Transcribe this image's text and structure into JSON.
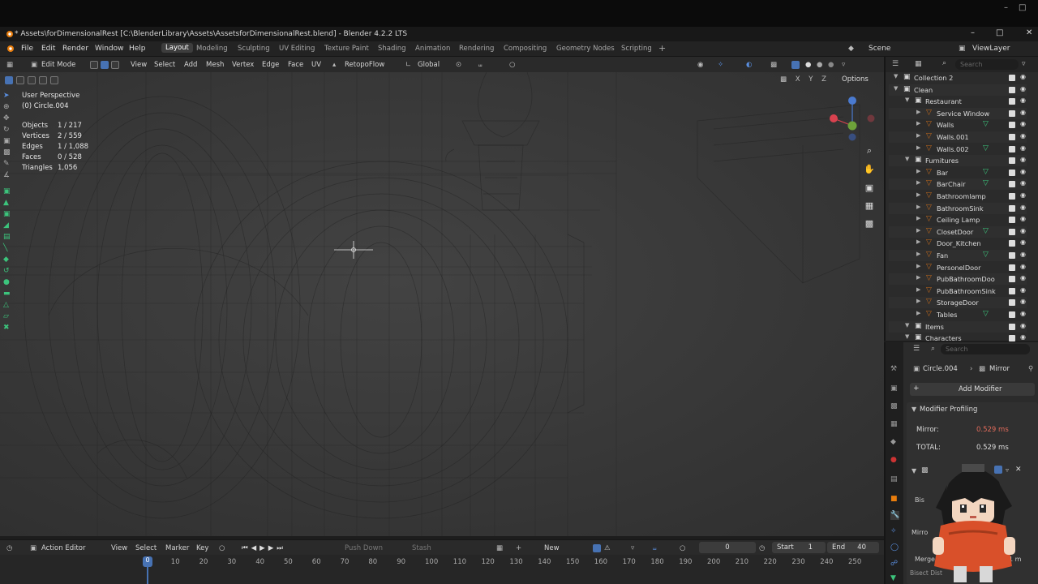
{
  "window": {
    "title": "* Assets\\forDimensionalRest [C:\\BlenderLibrary\\Assets\\AssetsforDimensionalRest.blend] - Blender 4.2.2 LTS"
  },
  "menu": {
    "items": [
      "File",
      "Edit",
      "Render",
      "Window",
      "Help"
    ],
    "workspaces": [
      "Layout",
      "Modeling",
      "Sculpting",
      "UV Editing",
      "Texture Paint",
      "Shading",
      "Animation",
      "Rendering",
      "Compositing",
      "Geometry Nodes",
      "Scripting"
    ],
    "add_tab": "+",
    "scene": "Scene",
    "view_layer": "ViewLayer"
  },
  "viewport_header": {
    "mode": "Edit Mode",
    "menus": [
      "View",
      "Select",
      "Add",
      "Mesh",
      "Vertex",
      "Edge",
      "Face",
      "UV"
    ],
    "addon": "RetopoFlow",
    "orientation": "Global",
    "options": "Options",
    "axes": [
      "X",
      "Y",
      "Z"
    ]
  },
  "viewport": {
    "perspective": "User Perspective",
    "object": "(0) Circle.004",
    "stats": [
      {
        "k": "Objects",
        "v": "1 / 217"
      },
      {
        "k": "Vertices",
        "v": "2 / 559"
      },
      {
        "k": "Edges",
        "v": "1 / 1,088"
      },
      {
        "k": "Faces",
        "v": "0 / 528"
      },
      {
        "k": "Triangles",
        "v": "1,056"
      }
    ]
  },
  "timeline": {
    "editor": "Action Editor",
    "menus": [
      "View",
      "Select",
      "Marker",
      "Key"
    ],
    "push_down": "Push Down",
    "stash": "Stash",
    "new": "New",
    "current_frame": "0",
    "start_label": "Start",
    "start": "1",
    "end_label": "End",
    "end": "40",
    "ticks": [
      "0",
      "10",
      "20",
      "30",
      "40",
      "50",
      "60",
      "70",
      "80",
      "90",
      "100",
      "110",
      "120",
      "130",
      "140",
      "150",
      "160",
      "170",
      "180",
      "190",
      "200",
      "210",
      "220",
      "230",
      "240",
      "250"
    ],
    "playhead": "0"
  },
  "outliner": {
    "search_placeholder": "Search",
    "rows": [
      {
        "label": "Collection 2",
        "indent": 0,
        "type": "collection"
      },
      {
        "label": "Clean",
        "indent": 0,
        "type": "collection"
      },
      {
        "label": "Restaurant",
        "indent": 1,
        "type": "collection"
      },
      {
        "label": "Service Window",
        "indent": 2,
        "type": "object"
      },
      {
        "label": "Walls",
        "indent": 2,
        "type": "object",
        "mod": true
      },
      {
        "label": "Walls.001",
        "indent": 2,
        "type": "object"
      },
      {
        "label": "Walls.002",
        "indent": 2,
        "type": "object",
        "mod": true
      },
      {
        "label": "Furnitures",
        "indent": 1,
        "type": "collection"
      },
      {
        "label": "Bar",
        "indent": 2,
        "type": "object",
        "mod": true
      },
      {
        "label": "BarChair",
        "indent": 2,
        "type": "object",
        "mod": true
      },
      {
        "label": "Bathroomlamp",
        "indent": 2,
        "type": "object"
      },
      {
        "label": "BathroomSink",
        "indent": 2,
        "type": "object"
      },
      {
        "label": "Ceiling Lamp",
        "indent": 2,
        "type": "object"
      },
      {
        "label": "ClosetDoor",
        "indent": 2,
        "type": "object",
        "mod": true
      },
      {
        "label": "Door_Kitchen",
        "indent": 2,
        "type": "object"
      },
      {
        "label": "Fan",
        "indent": 2,
        "type": "object",
        "mod": true
      },
      {
        "label": "PersonelDoor",
        "indent": 2,
        "type": "object"
      },
      {
        "label": "PubBathroomDoo",
        "indent": 2,
        "type": "object"
      },
      {
        "label": "PubBathroomSink",
        "indent": 2,
        "type": "object"
      },
      {
        "label": "StorageDoor",
        "indent": 2,
        "type": "object"
      },
      {
        "label": "Tables",
        "indent": 2,
        "type": "object",
        "mod": true
      },
      {
        "label": "Items",
        "indent": 1,
        "type": "collection"
      },
      {
        "label": "Characters",
        "indent": 1,
        "type": "collection"
      }
    ]
  },
  "properties": {
    "search_placeholder": "Search",
    "breadcrumb_object": "Circle.004",
    "breadcrumb_modifier": "Mirror",
    "add_modifier": "Add Modifier",
    "profiling_title": "Modifier Profiling",
    "mirror_label": "Mirror:",
    "mirror_value": "0.529 ms",
    "total_label": "TOTAL:",
    "total_value": "0.529 ms",
    "partial_labels": [
      "Bis",
      "Mirro",
      "Merge",
      "Bisect Dist"
    ],
    "merge_value": "1 m",
    "accent": "#4772b3",
    "mirror_value_color": "#e06a5a"
  }
}
